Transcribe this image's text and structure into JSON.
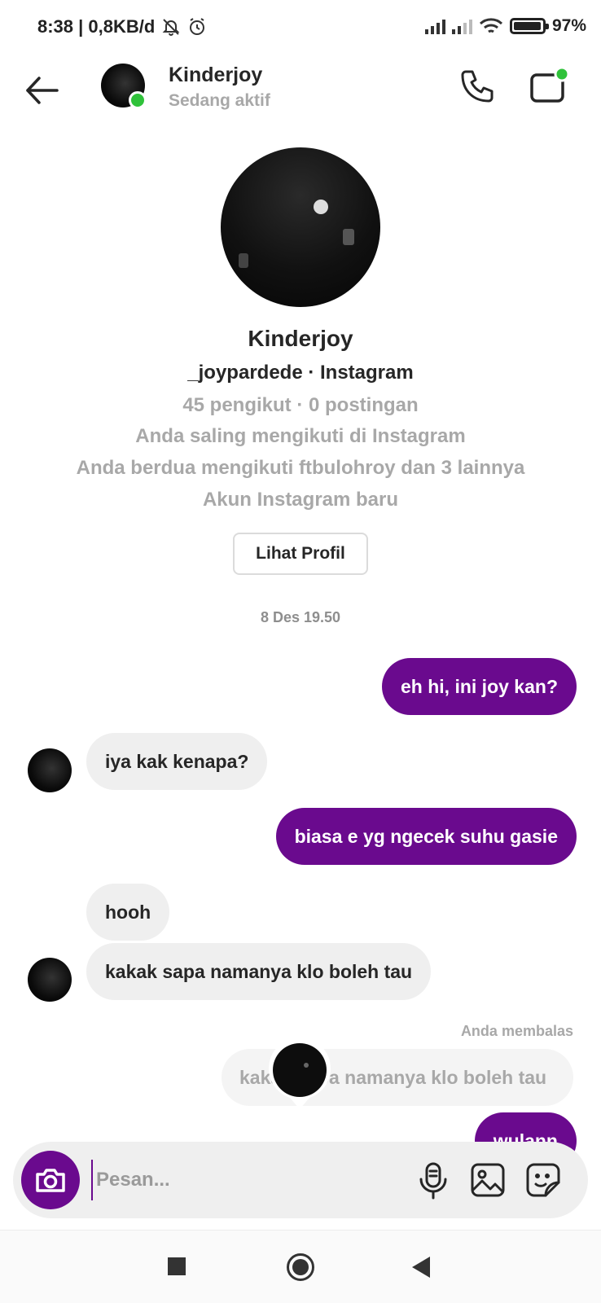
{
  "status_bar": {
    "left_text": "8:38 | 0,8KB/d",
    "battery_text": "97%",
    "battery_level": 0.97
  },
  "header": {
    "name": "Kinderjoy",
    "status": "Sedang aktif"
  },
  "profile": {
    "name": "Kinderjoy",
    "handle": "_joypardede · Instagram",
    "stats": "45 pengikut · 0 postingan",
    "mutual": "Anda saling mengikuti di Instagram",
    "followers_common": "Anda berdua mengikuti ftbulohroy dan 3 lainnya",
    "new_account": "Akun Instagram baru",
    "view_profile_label": "Lihat Profil"
  },
  "timestamp": "8 Des 19.50",
  "messages": [
    {
      "direction": "out",
      "text": "eh hi, ini joy kan?"
    },
    {
      "direction": "in",
      "text": "iya kak kenapa?"
    },
    {
      "direction": "out",
      "text": "biasa e yg ngecek suhu gasie"
    },
    {
      "direction": "in",
      "text": "hooh"
    },
    {
      "direction": "in",
      "text": "kakak sapa namanya klo boleh tau"
    },
    {
      "direction": "out",
      "text": "wulann"
    }
  ],
  "reply": {
    "label": "Anda membalas",
    "quoted_text": "kakak sapa namanya klo boleh tau"
  },
  "composer": {
    "placeholder": "Pesan..."
  },
  "colors": {
    "accent": "#6a0a8e",
    "online": "#2fc23a",
    "incoming_bubble": "#efefef"
  },
  "icons": [
    "back-arrow-icon",
    "phone-icon",
    "video-icon",
    "camera-icon",
    "microphone-icon",
    "gallery-icon",
    "sticker-icon"
  ]
}
